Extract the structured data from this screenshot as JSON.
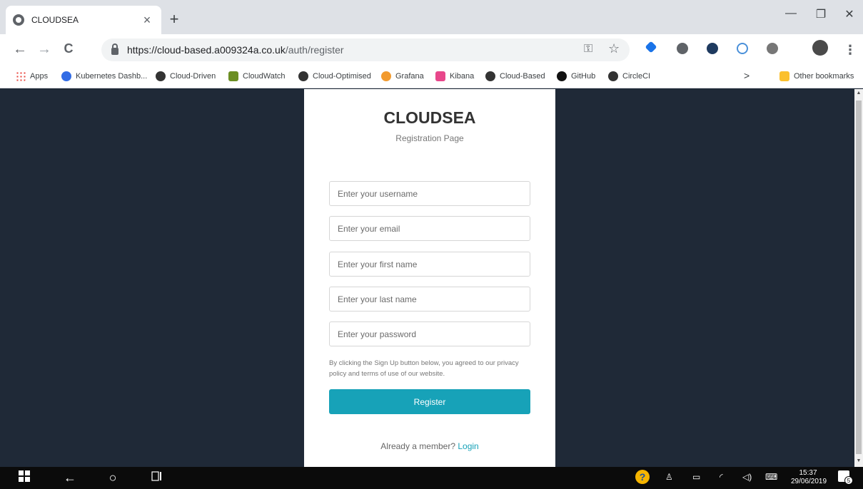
{
  "browser": {
    "tab_title": "CLOUDSEA",
    "tab_close": "×",
    "new_tab": "+",
    "window": {
      "minimize": "—",
      "maximize": "❐",
      "close": "✕"
    },
    "nav": {
      "back": "←",
      "forward": "→",
      "reload": "C"
    },
    "url_main": "https://cloud-based.a009324a.co.uk",
    "url_path": "/auth/register",
    "omnibox_icons": [
      "key-icon",
      "star-icon"
    ],
    "bookmarks": [
      {
        "label": "Apps",
        "icon": "apps-grid-icon",
        "color": "#e8453c"
      },
      {
        "label": "Kubernetes Dashb...",
        "icon": "kubernetes-icon",
        "color": "#326ce5"
      },
      {
        "label": "Cloud-Driven",
        "icon": "cloud-icon",
        "color": "#333333"
      },
      {
        "label": "CloudWatch",
        "icon": "cloudwatch-icon",
        "color": "#6b8e23"
      },
      {
        "label": "Cloud-Optimised",
        "icon": "cloud-icon",
        "color": "#333333"
      },
      {
        "label": "Grafana",
        "icon": "grafana-icon",
        "color": "#f29a2e"
      },
      {
        "label": "Kibana",
        "icon": "kibana-icon",
        "color": "#e8478b"
      },
      {
        "label": "Cloud-Based",
        "icon": "cloud-icon",
        "color": "#333333"
      },
      {
        "label": "GitHub",
        "icon": "github-icon",
        "color": "#111111"
      },
      {
        "label": "CircleCI",
        "icon": "circleci-icon",
        "color": "#333333"
      }
    ],
    "bookmarks_more": ">",
    "other_bookmarks": "Other bookmarks"
  },
  "page": {
    "brand": "CLOUDSEA",
    "subtitle": "Registration Page",
    "fields": {
      "username": "Enter your username",
      "email": "Enter your email",
      "first_name": "Enter your first name",
      "last_name": "Enter your last name",
      "password": "Enter your password"
    },
    "terms": "By clicking the Sign Up button below, you agreed to our privacy policy and terms of use of our website.",
    "register_button": "Register",
    "member_text": "Already a member?",
    "login_link": "Login",
    "accent_color": "#17a2b8",
    "background_color": "#1f2937"
  },
  "taskbar": {
    "time": "15:37",
    "date": "29/06/2019",
    "notification_count": "5"
  }
}
